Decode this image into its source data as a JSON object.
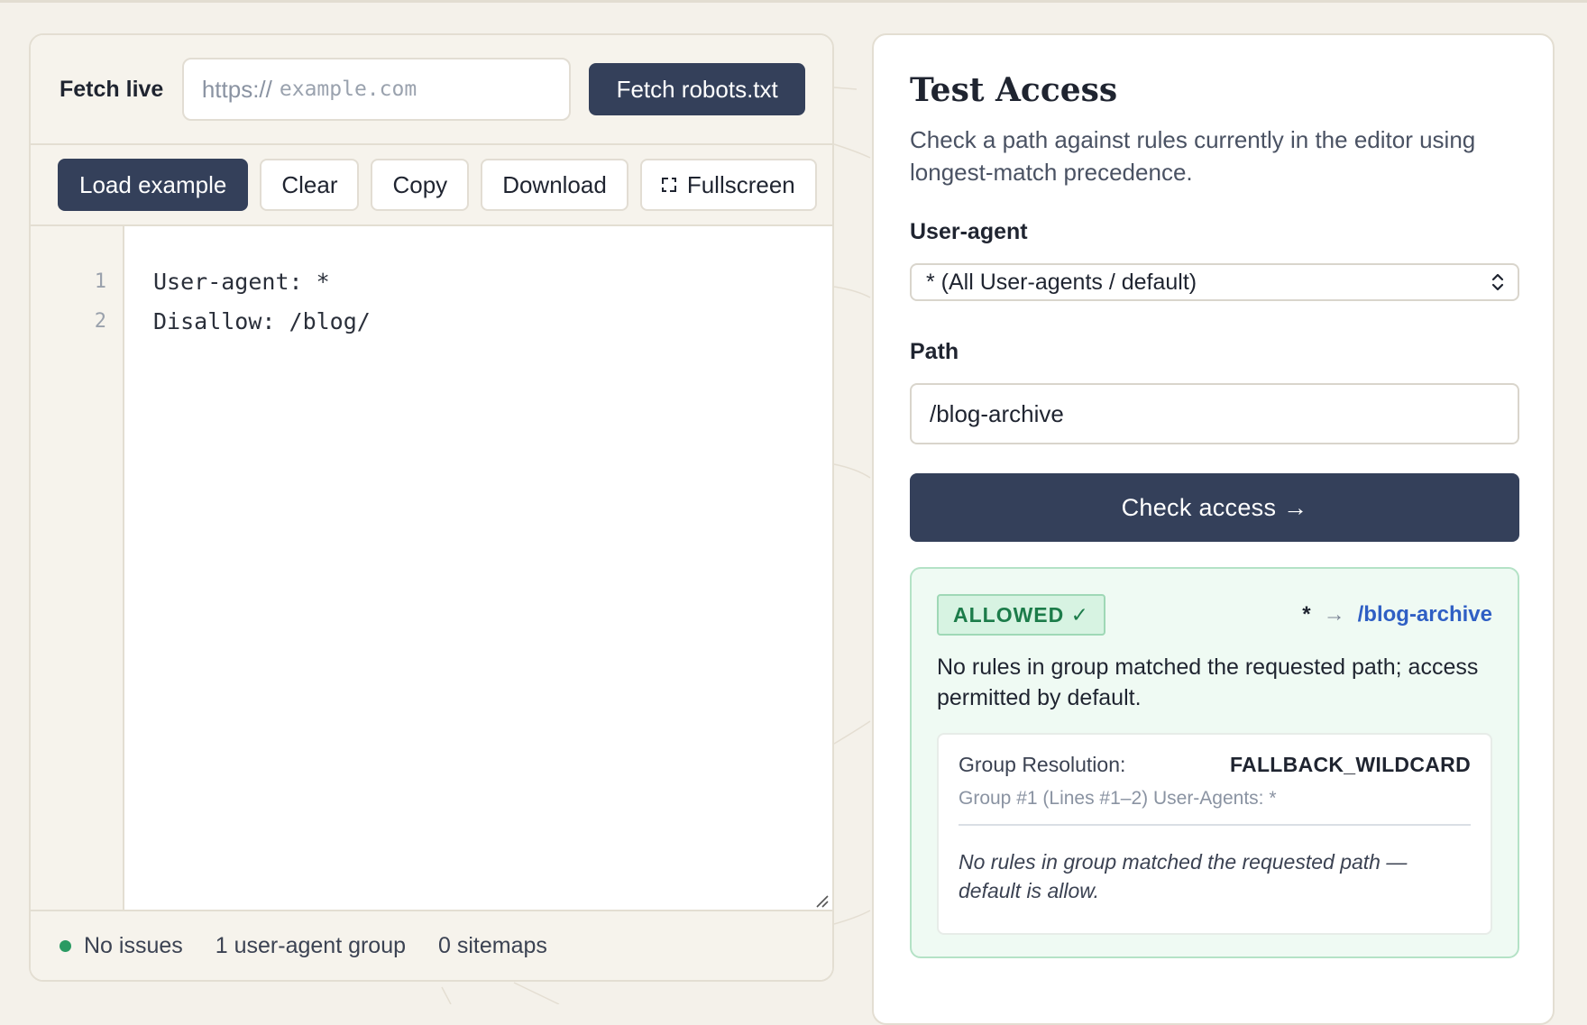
{
  "fetch": {
    "label": "Fetch live",
    "url_prefix": "https://",
    "url_placeholder": "example.com",
    "button": "Fetch robots.txt"
  },
  "toolbar": {
    "load_example": "Load example",
    "clear": "Clear",
    "copy": "Copy",
    "download": "Download",
    "fullscreen": "Fullscreen"
  },
  "editor": {
    "line_numbers": [
      "1",
      "2"
    ],
    "lines": [
      "User-agent: *",
      "Disallow: /blog/"
    ]
  },
  "status": {
    "issues": "No issues",
    "groups": "1 user-agent group",
    "sitemaps": "0 sitemaps",
    "ok_color": "#2a9a62"
  },
  "test": {
    "title": "Test Access",
    "description": "Check a path against rules currently in the editor using longest-match precedence.",
    "user_agent_label": "User-agent",
    "user_agent_value": "* (All User-agents / default)",
    "path_label": "Path",
    "path_value": "/blog-archive",
    "check_button": "Check access →"
  },
  "result": {
    "badge": "ALLOWED ✓",
    "agent": "*",
    "arrow": "→",
    "path": "/blog-archive",
    "message": "No rules in group matched the requested path; access permitted by default.",
    "group_resolution_label": "Group Resolution:",
    "group_resolution_value": "FALLBACK_WILDCARD",
    "group_detail": "Group #1 (Lines #1–2) User-Agents: *",
    "note": "No rules in group matched the requested path — default is allow."
  },
  "colors": {
    "primary_button": "#34405a",
    "allowed_bg": "#effaf3",
    "allowed_text": "#1c7c4a",
    "link": "#2f5fc4"
  }
}
